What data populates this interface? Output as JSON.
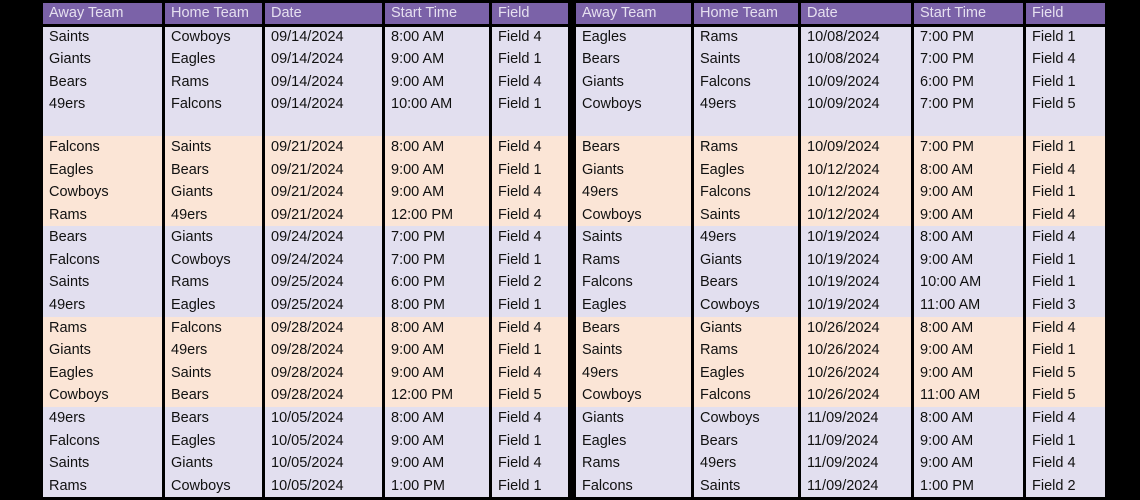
{
  "page": {
    "background_color": "#000000",
    "header_color": "#7B62A8",
    "header_text_color": "#E6E0F0",
    "band_lavender_color": "#E2DFEF",
    "band_peach_color": "#FBE5D6",
    "grid_line_color": "#000000"
  },
  "columns": {
    "away_team": "Away Team",
    "home_team": "Home Team",
    "date": "Date",
    "start_time": "Start Time",
    "field": "Field"
  },
  "left_table": {
    "headers": [
      "Away Team",
      "Home Team",
      "Date",
      "Start Time",
      "Field"
    ],
    "rows": [
      {
        "band": "lavender",
        "away": "Saints",
        "home": "Cowboys",
        "date": "09/14/2024",
        "time": "8:00 AM",
        "field": "Field 4"
      },
      {
        "band": "lavender",
        "away": "Giants",
        "home": "Eagles",
        "date": "09/14/2024",
        "time": "9:00 AM",
        "field": "Field 1"
      },
      {
        "band": "lavender",
        "away": "Bears",
        "home": "Rams",
        "date": "09/14/2024",
        "time": "9:00 AM",
        "field": "Field 4"
      },
      {
        "band": "lavender",
        "away": "49ers",
        "home": "Falcons",
        "date": "09/14/2024",
        "time": "10:00 AM",
        "field": "Field 1"
      },
      {
        "band": "spacer",
        "away": "",
        "home": "",
        "date": "",
        "time": "",
        "field": ""
      },
      {
        "band": "peach",
        "away": "Falcons",
        "home": "Saints",
        "date": "09/21/2024",
        "time": "8:00 AM",
        "field": "Field 4"
      },
      {
        "band": "peach",
        "away": "Eagles",
        "home": "Bears",
        "date": "09/21/2024",
        "time": "9:00 AM",
        "field": "Field 1"
      },
      {
        "band": "peach",
        "away": "Cowboys",
        "home": "Giants",
        "date": "09/21/2024",
        "time": "9:00 AM",
        "field": "Field 4"
      },
      {
        "band": "peach",
        "away": "Rams",
        "home": "49ers",
        "date": "09/21/2024",
        "time": "12:00 PM",
        "field": "Field 4"
      },
      {
        "band": "lavender",
        "away": "Bears",
        "home": "Giants",
        "date": "09/24/2024",
        "time": "7:00 PM",
        "field": "Field 4"
      },
      {
        "band": "lavender",
        "away": "Falcons",
        "home": "Cowboys",
        "date": "09/24/2024",
        "time": "7:00 PM",
        "field": "Field 1"
      },
      {
        "band": "lavender",
        "away": "Saints",
        "home": "Rams",
        "date": "09/25/2024",
        "time": "6:00 PM",
        "field": "Field 2"
      },
      {
        "band": "lavender",
        "away": "49ers",
        "home": "Eagles",
        "date": "09/25/2024",
        "time": "8:00 PM",
        "field": "Field 1"
      },
      {
        "band": "peach",
        "away": "Rams",
        "home": "Falcons",
        "date": "09/28/2024",
        "time": "8:00 AM",
        "field": "Field 4"
      },
      {
        "band": "peach",
        "away": "Giants",
        "home": "49ers",
        "date": "09/28/2024",
        "time": "9:00 AM",
        "field": "Field 1"
      },
      {
        "band": "peach",
        "away": "Eagles",
        "home": "Saints",
        "date": "09/28/2024",
        "time": "9:00 AM",
        "field": "Field 4"
      },
      {
        "band": "peach",
        "away": "Cowboys",
        "home": "Bears",
        "date": "09/28/2024",
        "time": "12:00 PM",
        "field": "Field 5"
      },
      {
        "band": "lavender",
        "away": "49ers",
        "home": "Bears",
        "date": "10/05/2024",
        "time": "8:00 AM",
        "field": "Field 4"
      },
      {
        "band": "lavender",
        "away": "Falcons",
        "home": "Eagles",
        "date": "10/05/2024",
        "time": "9:00 AM",
        "field": "Field 1"
      },
      {
        "band": "lavender",
        "away": "Saints",
        "home": "Giants",
        "date": "10/05/2024",
        "time": "9:00 AM",
        "field": "Field 4"
      },
      {
        "band": "lavender",
        "away": "Rams",
        "home": "Cowboys",
        "date": "10/05/2024",
        "time": "1:00 PM",
        "field": "Field 1"
      }
    ]
  },
  "right_table": {
    "headers": [
      "Away Team",
      "Home Team",
      "Date",
      "Start Time",
      "Field"
    ],
    "rows": [
      {
        "band": "lavender",
        "away": "Eagles",
        "home": "Rams",
        "date": "10/08/2024",
        "time": "7:00 PM",
        "field": "Field 1"
      },
      {
        "band": "lavender",
        "away": "Bears",
        "home": "Saints",
        "date": "10/08/2024",
        "time": "7:00 PM",
        "field": "Field 4"
      },
      {
        "band": "lavender",
        "away": "Giants",
        "home": "Falcons",
        "date": "10/09/2024",
        "time": "6:00 PM",
        "field": "Field 1"
      },
      {
        "band": "lavender",
        "away": "Cowboys",
        "home": "49ers",
        "date": "10/09/2024",
        "time": "7:00 PM",
        "field": "Field 5"
      },
      {
        "band": "spacer",
        "away": "",
        "home": "",
        "date": "",
        "time": "",
        "field": ""
      },
      {
        "band": "peach",
        "away": "Bears",
        "home": "Rams",
        "date": "10/09/2024",
        "time": "7:00 PM",
        "field": "Field 1"
      },
      {
        "band": "peach",
        "away": "Giants",
        "home": "Eagles",
        "date": "10/12/2024",
        "time": "8:00 AM",
        "field": "Field 4"
      },
      {
        "band": "peach",
        "away": "49ers",
        "home": "Falcons",
        "date": "10/12/2024",
        "time": "9:00 AM",
        "field": "Field 1"
      },
      {
        "band": "peach",
        "away": "Cowboys",
        "home": "Saints",
        "date": "10/12/2024",
        "time": "9:00 AM",
        "field": "Field 4"
      },
      {
        "band": "lavender",
        "away": "Saints",
        "home": "49ers",
        "date": "10/19/2024",
        "time": "8:00 AM",
        "field": "Field 4"
      },
      {
        "band": "lavender",
        "away": "Rams",
        "home": "Giants",
        "date": "10/19/2024",
        "time": "9:00 AM",
        "field": "Field 1"
      },
      {
        "band": "lavender",
        "away": "Falcons",
        "home": "Bears",
        "date": "10/19/2024",
        "time": "10:00 AM",
        "field": "Field 1"
      },
      {
        "band": "lavender",
        "away": "Eagles",
        "home": "Cowboys",
        "date": "10/19/2024",
        "time": "11:00 AM",
        "field": "Field 3"
      },
      {
        "band": "peach",
        "away": "Bears",
        "home": "Giants",
        "date": "10/26/2024",
        "time": "8:00 AM",
        "field": "Field 4"
      },
      {
        "band": "peach",
        "away": "Saints",
        "home": "Rams",
        "date": "10/26/2024",
        "time": "9:00 AM",
        "field": "Field 1"
      },
      {
        "band": "peach",
        "away": "49ers",
        "home": "Eagles",
        "date": "10/26/2024",
        "time": "9:00 AM",
        "field": "Field 5"
      },
      {
        "band": "peach",
        "away": "Cowboys",
        "home": "Falcons",
        "date": "10/26/2024",
        "time": "11:00 AM",
        "field": "Field 5"
      },
      {
        "band": "lavender",
        "away": "Giants",
        "home": "Cowboys",
        "date": "11/09/2024",
        "time": "8:00 AM",
        "field": "Field 4"
      },
      {
        "band": "lavender",
        "away": "Eagles",
        "home": "Bears",
        "date": "11/09/2024",
        "time": "9:00 AM",
        "field": "Field 1"
      },
      {
        "band": "lavender",
        "away": "Rams",
        "home": "49ers",
        "date": "11/09/2024",
        "time": "9:00 AM",
        "field": "Field 4"
      },
      {
        "band": "lavender",
        "away": "Falcons",
        "home": "Saints",
        "date": "11/09/2024",
        "time": "1:00 PM",
        "field": "Field 2"
      }
    ]
  }
}
